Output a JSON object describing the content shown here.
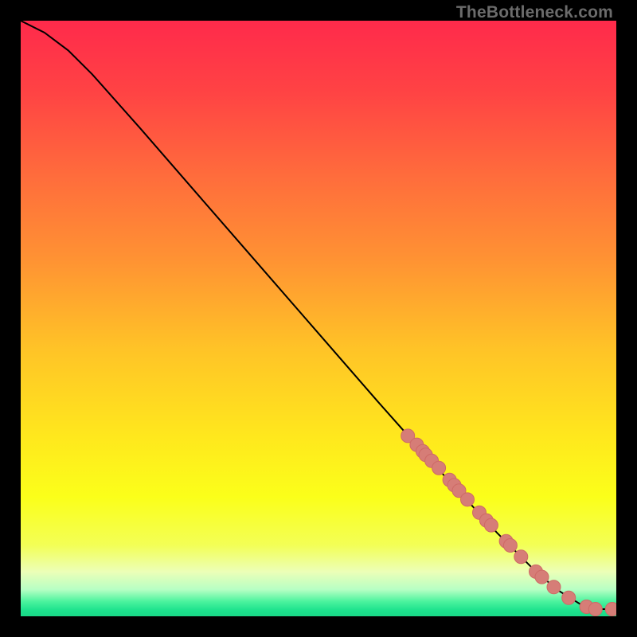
{
  "watermark": "TheBottleneck.com",
  "colors": {
    "black": "#000000",
    "line": "#000000",
    "marker_fill": "#d67d77",
    "marker_stroke": "#ce6a66"
  },
  "chart_data": {
    "type": "line",
    "title": "",
    "xlabel": "",
    "ylabel": "",
    "xlim": [
      0,
      100
    ],
    "ylim": [
      0,
      100
    ],
    "grid": false,
    "legend": false,
    "gradient_stops": [
      {
        "offset": 0.0,
        "color": "#ff2a4b"
      },
      {
        "offset": 0.12,
        "color": "#ff4344"
      },
      {
        "offset": 0.26,
        "color": "#ff6c3c"
      },
      {
        "offset": 0.4,
        "color": "#ff9233"
      },
      {
        "offset": 0.55,
        "color": "#ffc327"
      },
      {
        "offset": 0.7,
        "color": "#ffe81d"
      },
      {
        "offset": 0.8,
        "color": "#fbff1a"
      },
      {
        "offset": 0.88,
        "color": "#f3ff55"
      },
      {
        "offset": 0.925,
        "color": "#ecffb7"
      },
      {
        "offset": 0.955,
        "color": "#b7ffc4"
      },
      {
        "offset": 0.975,
        "color": "#4cf39e"
      },
      {
        "offset": 0.99,
        "color": "#1de28d"
      },
      {
        "offset": 1.0,
        "color": "#19d987"
      }
    ],
    "curve": {
      "x": [
        0,
        4,
        8,
        12,
        20,
        30,
        40,
        50,
        60,
        68,
        74,
        80,
        86,
        90,
        94,
        97,
        100
      ],
      "y": [
        100,
        98,
        95,
        91,
        82,
        70.5,
        59,
        47.5,
        36,
        27,
        20.5,
        14,
        8,
        4.5,
        2,
        1.2,
        1.2
      ]
    },
    "markers": {
      "x": [
        65,
        66.5,
        67.5,
        68,
        69,
        70.2,
        72,
        72.8,
        73.6,
        75,
        77,
        78.2,
        79,
        81.5,
        82.2,
        84,
        86.5,
        87.5,
        89.5,
        92,
        95,
        96.5,
        99.3
      ],
      "y": [
        30.3,
        28.8,
        27.7,
        27.1,
        26.1,
        24.9,
        22.9,
        22.0,
        21.1,
        19.6,
        17.4,
        16.1,
        15.3,
        12.6,
        11.9,
        10.0,
        7.5,
        6.6,
        4.9,
        3.1,
        1.6,
        1.2,
        1.2
      ]
    }
  }
}
